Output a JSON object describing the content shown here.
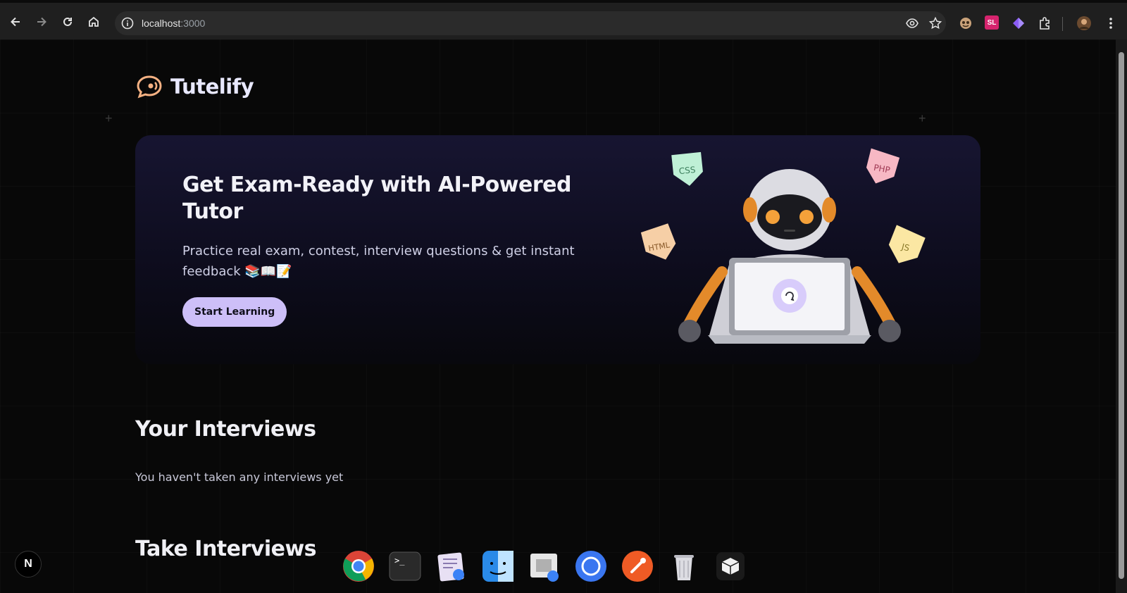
{
  "browser": {
    "url_host": "localhost",
    "url_port": ":3000",
    "icons": [
      "back-icon",
      "forward-icon",
      "reload-icon",
      "home-icon",
      "site-info-icon",
      "eye-icon",
      "star-icon",
      "extension-cookie-icon",
      "extension-sl-icon",
      "extension-diamond-icon",
      "extensions-puzzle-icon",
      "profile-avatar",
      "menu-kebab-icon"
    ],
    "ext_sl_label": "SL"
  },
  "site": {
    "brand": "Tutelify"
  },
  "hero": {
    "title": "Get Exam-Ready with AI-Powered Tutor",
    "subtitle": "Practice real exam, contest, interview questions & get instant feedback 📚📖📝",
    "cta_label": "Start Learning",
    "badges": [
      "CSS",
      "PHP",
      "HTML",
      "JS"
    ]
  },
  "sections": {
    "your_interviews_title": "Your Interviews",
    "your_interviews_empty": "You haven't taken any interviews yet",
    "take_interviews_title": "Take Interviews"
  },
  "next_badge_label": "N",
  "dock": {
    "apps": [
      "chrome-icon",
      "terminal-icon",
      "script-editor-icon",
      "finder-icon",
      "preview-icon",
      "signal-icon",
      "postman-icon",
      "trash-icon",
      "box-icon"
    ]
  },
  "colors": {
    "accent": "#cdbff8",
    "brand_logo": "#f4b183",
    "background": "#080808"
  }
}
